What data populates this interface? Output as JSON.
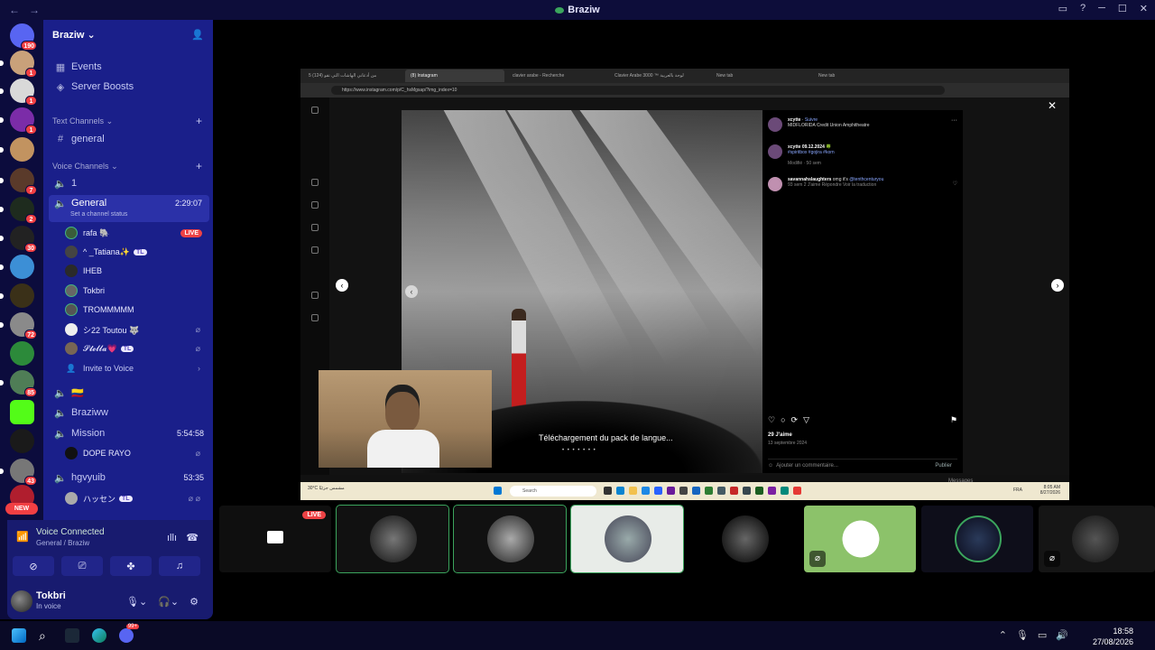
{
  "window": {
    "title": "Braziw"
  },
  "rail": {
    "home_badge": "190",
    "servers": [
      {
        "badge": "1"
      },
      {
        "badge": "1"
      },
      {
        "badge": "1"
      },
      {
        "badge": ""
      },
      {
        "badge": "7"
      },
      {
        "badge": "2"
      },
      {
        "badge": "30"
      },
      {
        "badge": ""
      },
      {
        "badge": ""
      },
      {
        "badge": "72"
      },
      {
        "badge": ""
      },
      {
        "badge": "85"
      },
      {
        "badge": ""
      },
      {
        "badge": ""
      },
      {
        "badge": "43"
      }
    ],
    "new_label": "NEW"
  },
  "sidebar": {
    "guild_name": "Braziw",
    "events": "Events",
    "boosts": "Server Boosts",
    "text_channels_label": "Text Channels",
    "text_channels": [
      "general"
    ],
    "voice_channels_label": "Voice Channels",
    "vc_1": "1",
    "vc_general": {
      "name": "General",
      "time": "2:29:07",
      "status": "Set a channel status"
    },
    "users": [
      {
        "name": "rafa 🐘",
        "live": "LIVE",
        "tl": ""
      },
      {
        "name": "^ _Tatiana✨",
        "live": "",
        "tl": "TL"
      },
      {
        "name": "IHEB",
        "live": "",
        "tl": ""
      },
      {
        "name": "Tokbri",
        "live": "",
        "tl": ""
      },
      {
        "name": "TROMMMMM",
        "live": "",
        "tl": ""
      },
      {
        "name": "シ22 Toutou 🐺",
        "live": "",
        "tl": ""
      },
      {
        "name": "𝓢𝓽𝓮𝓵𝓵𝓪💗",
        "live": "",
        "tl": "TL"
      }
    ],
    "invite": "Invite to Voice",
    "vc_flag": "🇨🇴",
    "vc_braziww": "Braziww",
    "vc_mission": {
      "name": "Mission",
      "time": "5:54:58"
    },
    "mission_user": "DOPE RAYO",
    "vc_hgvyuib": {
      "name": "hgvyuib",
      "time": "53:35"
    },
    "hg_user": {
      "name": "ハッセン",
      "tl": "TL"
    }
  },
  "voice_panel": {
    "title": "Voice Connected",
    "sub": "General / Braziw",
    "user_name": "Tokbri",
    "user_status": "In voice"
  },
  "stream": {
    "tabs": [
      "5 (124) من أدعاني الهاشات التي تقو",
      "(8) Instagram",
      "clavier arabe - Recherche",
      "Clavier Arabe 3000 ™ لوحة بالعربية",
      "New tab",
      "New tab"
    ],
    "url": "https://www.instagram.com/p/C_hsMgsap/?img_index=10",
    "caption": "Téléchargement du pack de langue...",
    "post": {
      "author": "xcytte",
      "follow": "Suivre",
      "location": "MIDFLORIDA Credit Union Amphitheatre",
      "c1_head": "xcytte 09.12.2024 🍀",
      "c1_tags": "#spiritbox #gojira #korn",
      "c1_meta": "Modifié · 50 sem",
      "c2_user": "savannahslaughters",
      "c2_text": "omg it's",
      "c2_mention": "@tenthcenturyou",
      "c2_meta": "93 sem   2 J'aime   Répondre   Voir la traduction",
      "likes": "29 J'aime",
      "date": "13 septembre 2024",
      "add_comment": "Ajouter un commentaire...",
      "publish": "Publier"
    },
    "messages": "Messages",
    "taskbar": {
      "weather": "30°C",
      "weather_sub": "مشمس جزئيًا",
      "search": "Search",
      "time": "8:05 AM",
      "date": "8/27/2026",
      "lang": "FRA"
    }
  },
  "tiles": {
    "live": "LIVE",
    "count": 8
  },
  "taskbar": {
    "time": "18:58",
    "date": "27/08/2026",
    "discord_badge": "99+"
  }
}
